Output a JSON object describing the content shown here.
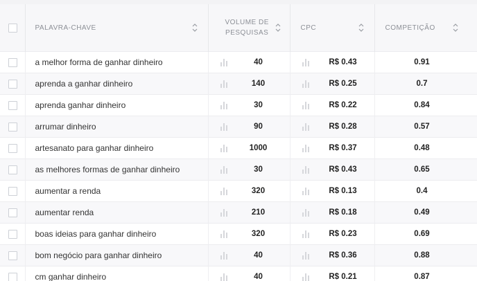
{
  "table": {
    "columns": {
      "keyword": "PALAVRA-CHAVE",
      "volume_line1": "VOLUME DE",
      "volume_line2": "PESQUISAS",
      "cpc": "CPC",
      "competition": "COMPETIÇÃO"
    },
    "rows": [
      {
        "keyword": "a melhor forma de ganhar dinheiro",
        "volume": "40",
        "cpc": "R$ 0.43",
        "competition": "0.91"
      },
      {
        "keyword": "aprenda a ganhar dinheiro",
        "volume": "140",
        "cpc": "R$ 0.25",
        "competition": "0.7"
      },
      {
        "keyword": "aprenda ganhar dinheiro",
        "volume": "30",
        "cpc": "R$ 0.22",
        "competition": "0.84"
      },
      {
        "keyword": "arrumar dinheiro",
        "volume": "90",
        "cpc": "R$ 0.28",
        "competition": "0.57"
      },
      {
        "keyword": "artesanato para ganhar dinheiro",
        "volume": "1000",
        "cpc": "R$ 0.37",
        "competition": "0.48"
      },
      {
        "keyword": "as melhores formas de ganhar dinheiro",
        "volume": "30",
        "cpc": "R$ 0.43",
        "competition": "0.65"
      },
      {
        "keyword": "aumentar a renda",
        "volume": "320",
        "cpc": "R$ 0.13",
        "competition": "0.4"
      },
      {
        "keyword": "aumentar renda",
        "volume": "210",
        "cpc": "R$ 0.18",
        "competition": "0.49"
      },
      {
        "keyword": "boas ideias para ganhar dinheiro",
        "volume": "320",
        "cpc": "R$ 0.23",
        "competition": "0.69"
      },
      {
        "keyword": "bom negócio para ganhar dinheiro",
        "volume": "40",
        "cpc": "R$ 0.36",
        "competition": "0.88"
      },
      {
        "keyword": "cm ganhar dinheiro",
        "volume": "40",
        "cpc": "R$ 0.21",
        "competition": "0.87"
      }
    ]
  },
  "icons": {
    "sort": "sort-updown-icon",
    "trend": "bar-chart-icon",
    "checkbox": "checkbox"
  },
  "colors": {
    "header_bg": "#f7f7f9",
    "row_alt_bg": "#f8f8fa",
    "header_text": "#8c8f96",
    "icon_gray": "#d6d7db"
  }
}
